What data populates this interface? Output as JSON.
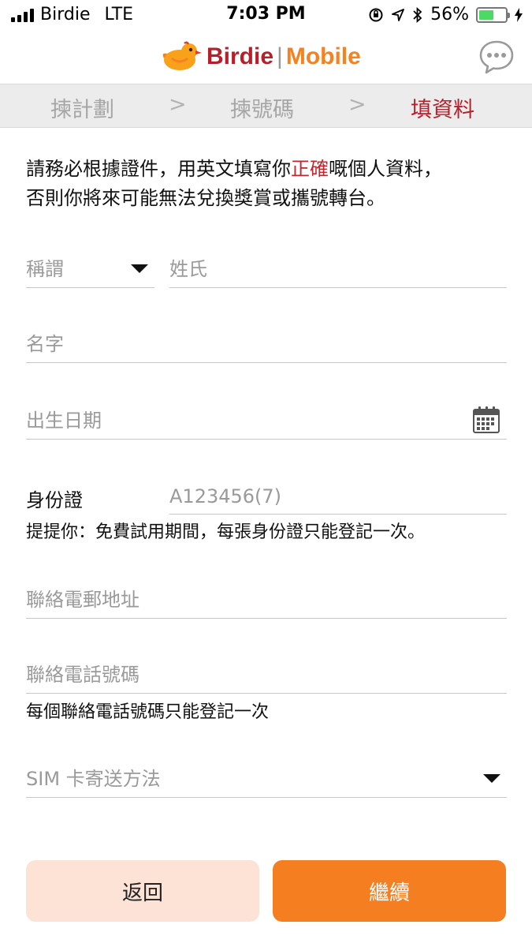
{
  "status_bar": {
    "carrier": "Birdie",
    "network": "LTE",
    "time": "7:03 PM",
    "battery": "56%",
    "battery_level": 0.56
  },
  "header": {
    "logo_brand": "Birdie",
    "logo_product": "Mobile",
    "chat_icon": "chat-bubble-icon"
  },
  "steps": [
    {
      "label": "揀計劃",
      "active": false
    },
    {
      "label": "揀號碼",
      "active": false
    },
    {
      "label": "填資料",
      "active": true
    }
  ],
  "intro": {
    "part1": "請務必根據證件，用英文填寫你",
    "highlight": "正確",
    "part2": "嘅個人資料，",
    "line2": "否則你將來可能無法兌換獎賞或攜號轉台。"
  },
  "form": {
    "title_placeholder": "稱謂",
    "surname_placeholder": "姓氏",
    "given_name_placeholder": "名字",
    "dob_placeholder": "出生日期",
    "id_label": "身份證",
    "id_placeholder": "A123456(7)",
    "id_hint": "提提你：免費試用期間，每張身份證只能登記一次。",
    "email_placeholder": "聯絡電郵地址",
    "phone_placeholder": "聯絡電話號碼",
    "phone_hint": "每個聯絡電話號碼只能登記一次",
    "sim_delivery_placeholder": "SIM 卡寄送方法"
  },
  "buttons": {
    "back": "返回",
    "continue": "繼續"
  },
  "colors": {
    "brand_red": "#b5202a",
    "brand_orange": "#f57f20",
    "back_button_bg": "#fde3d6"
  }
}
